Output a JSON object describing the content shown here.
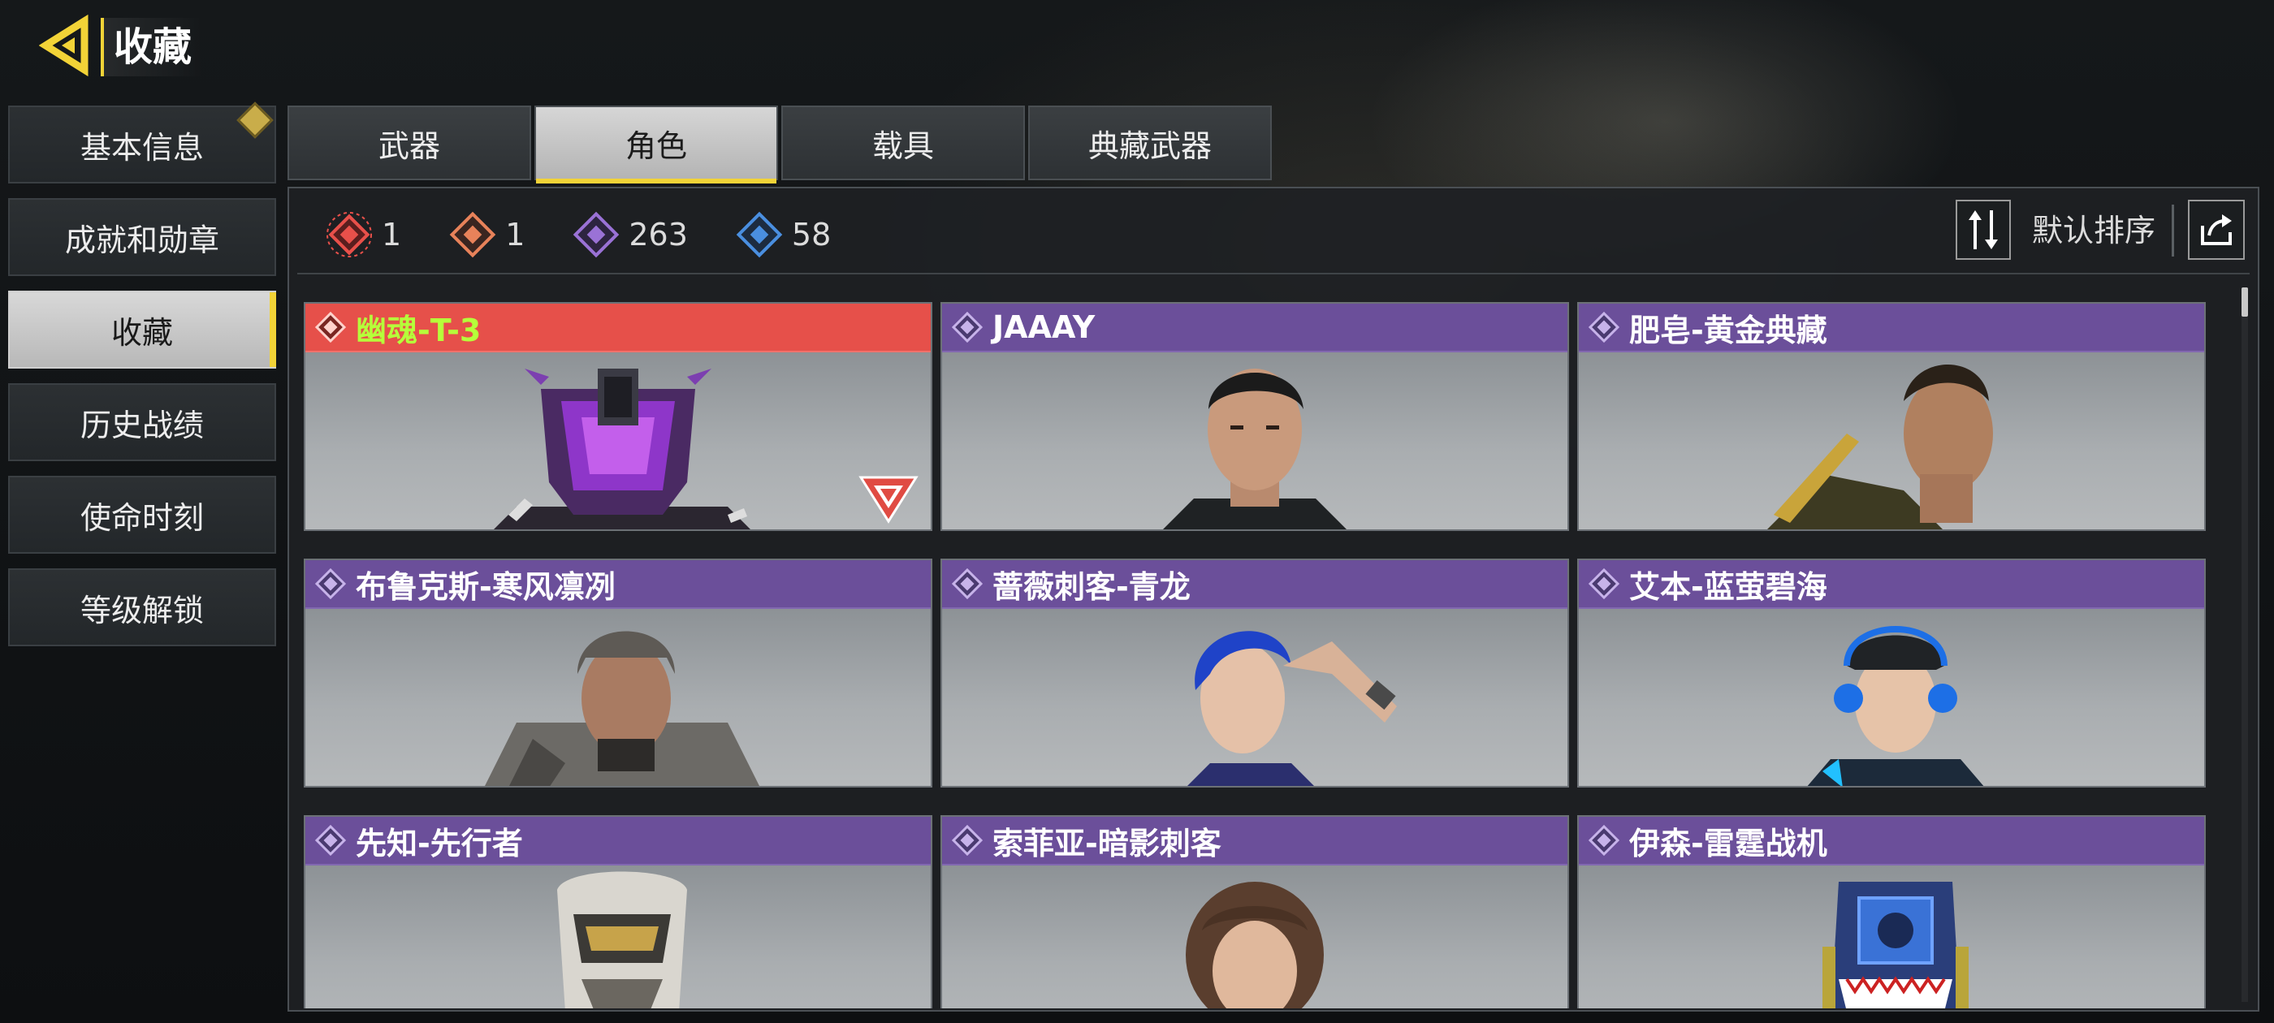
{
  "header": {
    "title": "收藏"
  },
  "nav": {
    "items": [
      {
        "label": "基本信息",
        "active": false,
        "badge": true
      },
      {
        "label": "成就和勋章",
        "active": false,
        "badge": false
      },
      {
        "label": "收藏",
        "active": true,
        "badge": false
      },
      {
        "label": "历史战绩",
        "active": false,
        "badge": false
      },
      {
        "label": "使命时刻",
        "active": false,
        "badge": false
      },
      {
        "label": "等级解锁",
        "active": false,
        "badge": false
      }
    ]
  },
  "tabs": [
    {
      "label": "武器",
      "active": false
    },
    {
      "label": "角色",
      "active": true
    },
    {
      "label": "载具",
      "active": false
    },
    {
      "label": "典藏武器",
      "active": false
    }
  ],
  "stats": [
    {
      "icon": "mythic-rarity-icon",
      "color": "#e8504a",
      "count": "1"
    },
    {
      "icon": "legendary-rarity-icon",
      "color": "#e8825a",
      "count": "1"
    },
    {
      "icon": "epic-rarity-icon",
      "color": "#9a72d6",
      "count": "263"
    },
    {
      "icon": "rare-rarity-icon",
      "color": "#4a8fe0",
      "count": "58"
    }
  ],
  "sort": {
    "label": "默认排序"
  },
  "characters": [
    {
      "name": "幽魂-T-3",
      "rarity": "mythic",
      "has_badge": true
    },
    {
      "name": "JAAAY",
      "rarity": "epic",
      "has_badge": false
    },
    {
      "name": "肥皂-黄金典藏",
      "rarity": "epic",
      "has_badge": false
    },
    {
      "name": "布鲁克斯-寒风凛冽",
      "rarity": "epic",
      "has_badge": false
    },
    {
      "name": "蔷薇刺客-青龙",
      "rarity": "epic",
      "has_badge": false
    },
    {
      "name": "艾本-蓝萤碧海",
      "rarity": "epic",
      "has_badge": false
    },
    {
      "name": "先知-先行者",
      "rarity": "epic",
      "has_badge": false
    },
    {
      "name": "索菲亚-暗影刺客",
      "rarity": "epic",
      "has_badge": false
    },
    {
      "name": "伊森-雷霆战机",
      "rarity": "epic",
      "has_badge": false
    }
  ],
  "colors": {
    "accent": "#f2d337",
    "mythic_header": "#e6504a",
    "epic_header": "#6b4f9a",
    "mythic_name": "#b6ff3a"
  }
}
